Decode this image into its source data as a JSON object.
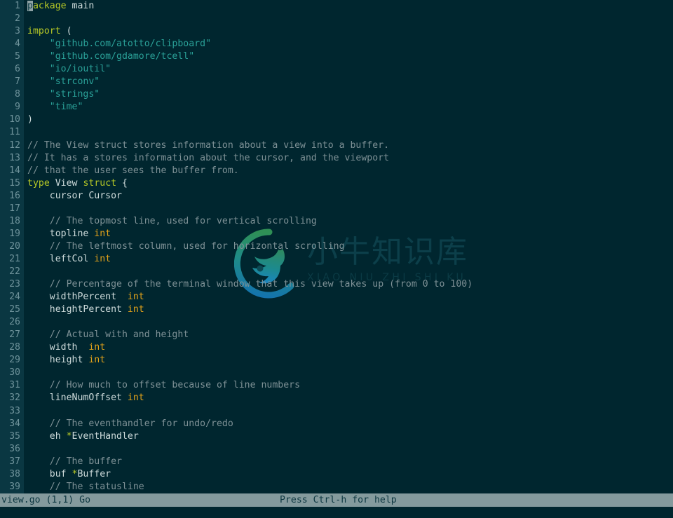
{
  "app": {
    "name": "micro-editor",
    "background": "#00262f",
    "gutter_background": "#0a3742",
    "statusbar_background": "#849a9d"
  },
  "watermark": {
    "chinese": "小牛知识库",
    "pinyin": "XIAO NIU ZHI SHI KU",
    "logo_icon": "bull-head-circle-logo",
    "logo_color_top": "#2e7d4f",
    "logo_color_bottom": "#1c6f9c"
  },
  "statusbar": {
    "left": "view.go (1,1) Go",
    "right": "Press Ctrl-h for help"
  },
  "editor": {
    "cursor_char": "p",
    "lines": [
      {
        "n": "1",
        "tokens": [
          {
            "c": "cursor",
            "t": "p"
          },
          {
            "c": "t-kw",
            "t": "ackage"
          },
          {
            "c": "t-plain",
            "t": " "
          },
          {
            "c": "t-ident",
            "t": "main"
          }
        ]
      },
      {
        "n": "2",
        "tokens": []
      },
      {
        "n": "3",
        "tokens": [
          {
            "c": "t-kw",
            "t": "import"
          },
          {
            "c": "t-plain",
            "t": " "
          },
          {
            "c": "t-punct",
            "t": "("
          }
        ]
      },
      {
        "n": "4",
        "tokens": [
          {
            "c": "t-str",
            "t": "    \"github.com/atotto/clipboard\""
          }
        ]
      },
      {
        "n": "5",
        "tokens": [
          {
            "c": "t-str",
            "t": "    \"github.com/gdamore/tcell\""
          }
        ]
      },
      {
        "n": "6",
        "tokens": [
          {
            "c": "t-str",
            "t": "    \"io/ioutil\""
          }
        ]
      },
      {
        "n": "7",
        "tokens": [
          {
            "c": "t-str",
            "t": "    \"strconv\""
          }
        ]
      },
      {
        "n": "8",
        "tokens": [
          {
            "c": "t-str",
            "t": "    \"strings\""
          }
        ]
      },
      {
        "n": "9",
        "tokens": [
          {
            "c": "t-str",
            "t": "    \"time\""
          }
        ]
      },
      {
        "n": "10",
        "tokens": [
          {
            "c": "t-punct",
            "t": ")"
          }
        ]
      },
      {
        "n": "11",
        "tokens": []
      },
      {
        "n": "12",
        "tokens": [
          {
            "c": "t-cmt",
            "t": "// The View struct stores information about a view into a buffer."
          }
        ]
      },
      {
        "n": "13",
        "tokens": [
          {
            "c": "t-cmt",
            "t": "// It has a stores information about the cursor, and the viewport"
          }
        ]
      },
      {
        "n": "14",
        "tokens": [
          {
            "c": "t-cmt",
            "t": "// that the user sees the buffer from."
          }
        ]
      },
      {
        "n": "15",
        "tokens": [
          {
            "c": "t-kw",
            "t": "type"
          },
          {
            "c": "t-plain",
            "t": " "
          },
          {
            "c": "t-ident",
            "t": "View"
          },
          {
            "c": "t-plain",
            "t": " "
          },
          {
            "c": "t-kw",
            "t": "struct"
          },
          {
            "c": "t-plain",
            "t": " "
          },
          {
            "c": "t-punct",
            "t": "{"
          }
        ]
      },
      {
        "n": "16",
        "tokens": [
          {
            "c": "t-ident",
            "t": "    cursor Cursor"
          }
        ]
      },
      {
        "n": "17",
        "tokens": []
      },
      {
        "n": "18",
        "tokens": [
          {
            "c": "t-cmt",
            "t": "    // The topmost line, used for vertical scrolling"
          }
        ]
      },
      {
        "n": "19",
        "tokens": [
          {
            "c": "t-ident",
            "t": "    topline "
          },
          {
            "c": "t-type",
            "t": "int"
          }
        ]
      },
      {
        "n": "20",
        "tokens": [
          {
            "c": "t-cmt",
            "t": "    // The leftmost column, used for horizontal scrolling"
          }
        ]
      },
      {
        "n": "21",
        "tokens": [
          {
            "c": "t-ident",
            "t": "    leftCol "
          },
          {
            "c": "t-type",
            "t": "int"
          }
        ]
      },
      {
        "n": "22",
        "tokens": []
      },
      {
        "n": "23",
        "tokens": [
          {
            "c": "t-cmt",
            "t": "    // Percentage of the terminal window that this view takes up (from 0 to 100)"
          }
        ]
      },
      {
        "n": "24",
        "tokens": [
          {
            "c": "t-ident",
            "t": "    widthPercent  "
          },
          {
            "c": "t-type",
            "t": "int"
          }
        ]
      },
      {
        "n": "25",
        "tokens": [
          {
            "c": "t-ident",
            "t": "    heightPercent "
          },
          {
            "c": "t-type",
            "t": "int"
          }
        ]
      },
      {
        "n": "26",
        "tokens": []
      },
      {
        "n": "27",
        "tokens": [
          {
            "c": "t-cmt",
            "t": "    // Actual with and height"
          }
        ]
      },
      {
        "n": "28",
        "tokens": [
          {
            "c": "t-ident",
            "t": "    width  "
          },
          {
            "c": "t-type",
            "t": "int"
          }
        ]
      },
      {
        "n": "29",
        "tokens": [
          {
            "c": "t-ident",
            "t": "    height "
          },
          {
            "c": "t-type",
            "t": "int"
          }
        ]
      },
      {
        "n": "30",
        "tokens": []
      },
      {
        "n": "31",
        "tokens": [
          {
            "c": "t-cmt",
            "t": "    // How much to offset because of line numbers"
          }
        ]
      },
      {
        "n": "32",
        "tokens": [
          {
            "c": "t-ident",
            "t": "    lineNumOffset "
          },
          {
            "c": "t-type",
            "t": "int"
          }
        ]
      },
      {
        "n": "33",
        "tokens": []
      },
      {
        "n": "34",
        "tokens": [
          {
            "c": "t-cmt",
            "t": "    // The eventhandler for undo/redo"
          }
        ]
      },
      {
        "n": "35",
        "tokens": [
          {
            "c": "t-ident",
            "t": "    eh "
          },
          {
            "c": "t-star",
            "t": "*"
          },
          {
            "c": "t-ident",
            "t": "EventHandler"
          }
        ]
      },
      {
        "n": "36",
        "tokens": []
      },
      {
        "n": "37",
        "tokens": [
          {
            "c": "t-cmt",
            "t": "    // The buffer"
          }
        ]
      },
      {
        "n": "38",
        "tokens": [
          {
            "c": "t-ident",
            "t": "    buf "
          },
          {
            "c": "t-star",
            "t": "*"
          },
          {
            "c": "t-ident",
            "t": "Buffer"
          }
        ]
      },
      {
        "n": "39",
        "tokens": [
          {
            "c": "t-cmt",
            "t": "    // The statusline"
          }
        ]
      }
    ]
  }
}
